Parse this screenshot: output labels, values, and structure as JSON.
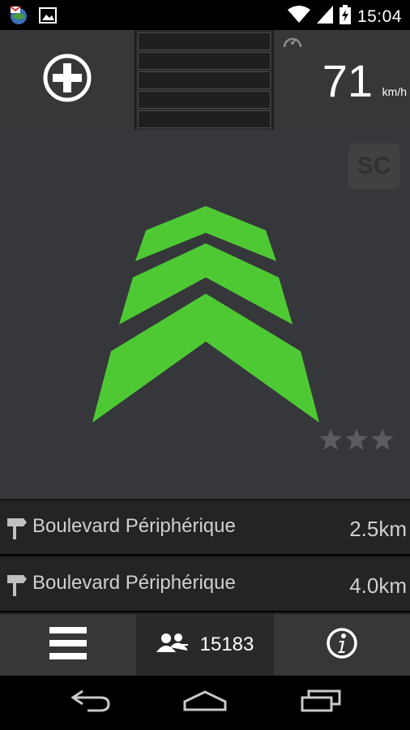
{
  "status_bar": {
    "time": "15:04",
    "icons": [
      "gmail-icon",
      "image-icon",
      "wifi-icon",
      "cell-signal-icon",
      "battery-charging-icon"
    ]
  },
  "top_bar": {
    "speed_value": "71",
    "speed_unit": "km/h",
    "signal_rows": 5
  },
  "main": {
    "badge_label": "SC",
    "rating_stars": 3,
    "chevron_color": "#4ec934"
  },
  "roads": [
    {
      "name": "Boulevard Périphérique",
      "distance": "2.5km"
    },
    {
      "name": "Boulevard Périphérique",
      "distance": "4.0km"
    }
  ],
  "bottom_bar": {
    "user_count": "15183"
  },
  "nav_bar": {
    "buttons": [
      "back-icon",
      "home-icon",
      "recents-icon"
    ]
  },
  "colors": {
    "panel": "#353739",
    "accent_green": "#4ec934",
    "text_secondary": "#cfd0d2"
  }
}
